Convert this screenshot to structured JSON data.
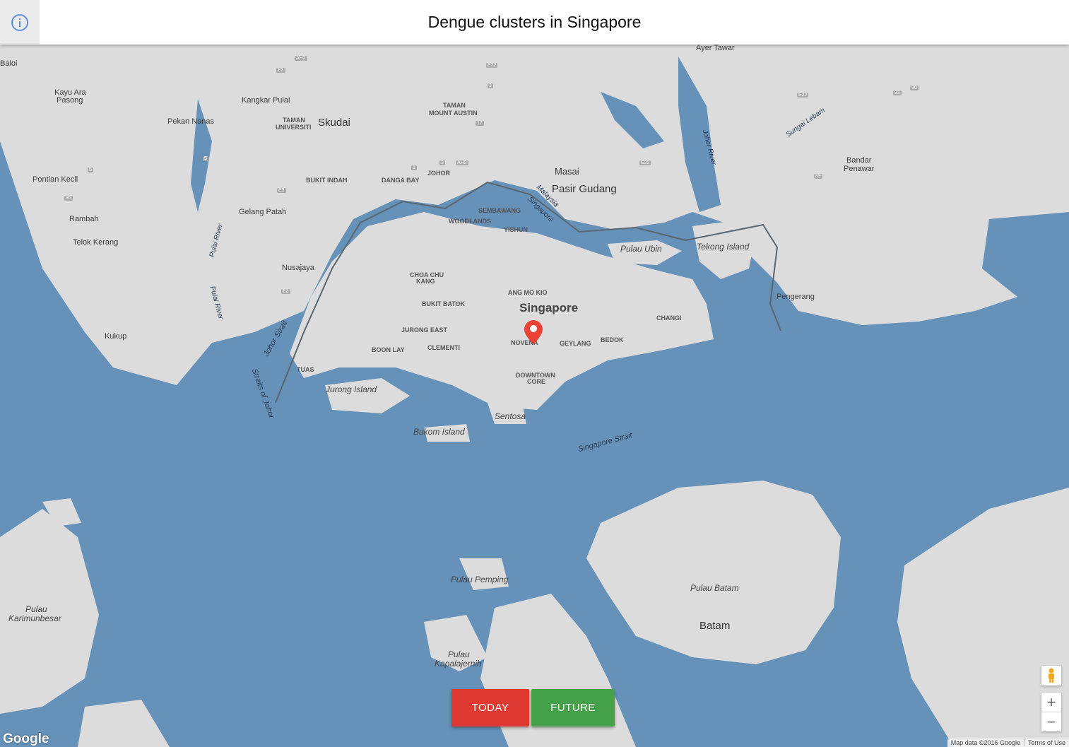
{
  "header": {
    "title": "Dengue clusters in Singapore"
  },
  "icons": {
    "info": "info-icon",
    "marker": "map-marker-icon",
    "pegman": "pegman-icon"
  },
  "colors": {
    "water": "#6691b9",
    "land": "#dcdcdc",
    "today": "#de3a32",
    "future": "#44a14a",
    "marker": "#ea4335"
  },
  "labels": {
    "ayer_tawar": "Ayer Tawar",
    "baloi": "Baloi",
    "kayu_ara_1": "Kayu Ara",
    "kayu_ara_2": "Pasong",
    "kangkar_pulai": "Kangkar Pulai",
    "taman_univ_1": "TAMAN",
    "taman_univ_2": "UNIVERSITI",
    "skudai": "Skudai",
    "pekan_nanas": "Pekan Nanas",
    "taman_austin_1": "TAMAN",
    "taman_austin_2": "MOUNT AUSTIN",
    "johor": "JOHOR",
    "bukit_indah": "BUKIT INDAH",
    "danga_bay": "DANGA BAY",
    "masai": "Masai",
    "pasir_gudang": "Pasir Gudang",
    "bandar_1": "Bandar",
    "bandar_2": "Penawar",
    "pontian": "Pontian Kecil",
    "gelang_patah": "Gelang Patah",
    "rambah": "Rambah",
    "telok_kerang": "Telok Kerang",
    "nusajaya": "Nusajaya",
    "kukup": "Kukup",
    "sembawang": "SEMBAWANG",
    "woodlands": "WOODLANDS",
    "yishun": "YISHUN",
    "choa_chu_1": "CHOA CHU",
    "choa_chu_2": "KANG",
    "ang_mo_kio": "ANG MO KIO",
    "singapore": "Singapore",
    "bukit_batok": "BUKIT BATOK",
    "changi": "CHANGI",
    "jurong_east": "JURONG EAST",
    "novena": "NOVENA",
    "geylang": "GEYLANG",
    "bedok": "BEDOK",
    "boon_lay": "BOON LAY",
    "clementi": "CLEMENTI",
    "tuas": "TUAS",
    "downtown_1": "DOWNTOWN",
    "downtown_2": "CORE",
    "jurong_island": "Jurong Island",
    "sentosa": "Sentosa",
    "bukom": "Bukom Island",
    "pulau_ubin": "Pulau Ubin",
    "tekong": "Tekong Island",
    "pengerang": "Pengerang",
    "johor_strait": "Johor Strait",
    "straits_johor": "Straits of Johor",
    "singapore_strait": "Singapore Strait",
    "malaysia_sg_1": "Malaysia",
    "malaysia_sg_2": "Singapore",
    "johor_river": "Johor River",
    "sungai_lebam": "Sungai Lebam",
    "pulai_river_1": "Pulai River",
    "pulai_river_2": "Pulai River",
    "pulau_pemping": "Pulau Pemping",
    "pulau_batam": "Pulau Batam",
    "batam": "Batam",
    "karimun_1": "Pulau",
    "karimun_2": "Karimunbesar",
    "kapala_1": "Pulau",
    "kapala_2": "Kapalajernih"
  },
  "shields": [
    "AH2",
    "E3",
    "E22",
    "3",
    "17",
    "5",
    "5",
    "95",
    "E3",
    "1",
    "3",
    "AH2",
    "E3",
    "E22",
    "E22",
    "92",
    "90",
    "89"
  ],
  "buttons": {
    "today": "TODAY",
    "future": "FUTURE"
  },
  "controls": {
    "zoom_in": "+",
    "zoom_out": "−"
  },
  "footer": {
    "logo": "Google",
    "map_data": "Map data ©2016 Google",
    "terms": "Terms of Use"
  }
}
